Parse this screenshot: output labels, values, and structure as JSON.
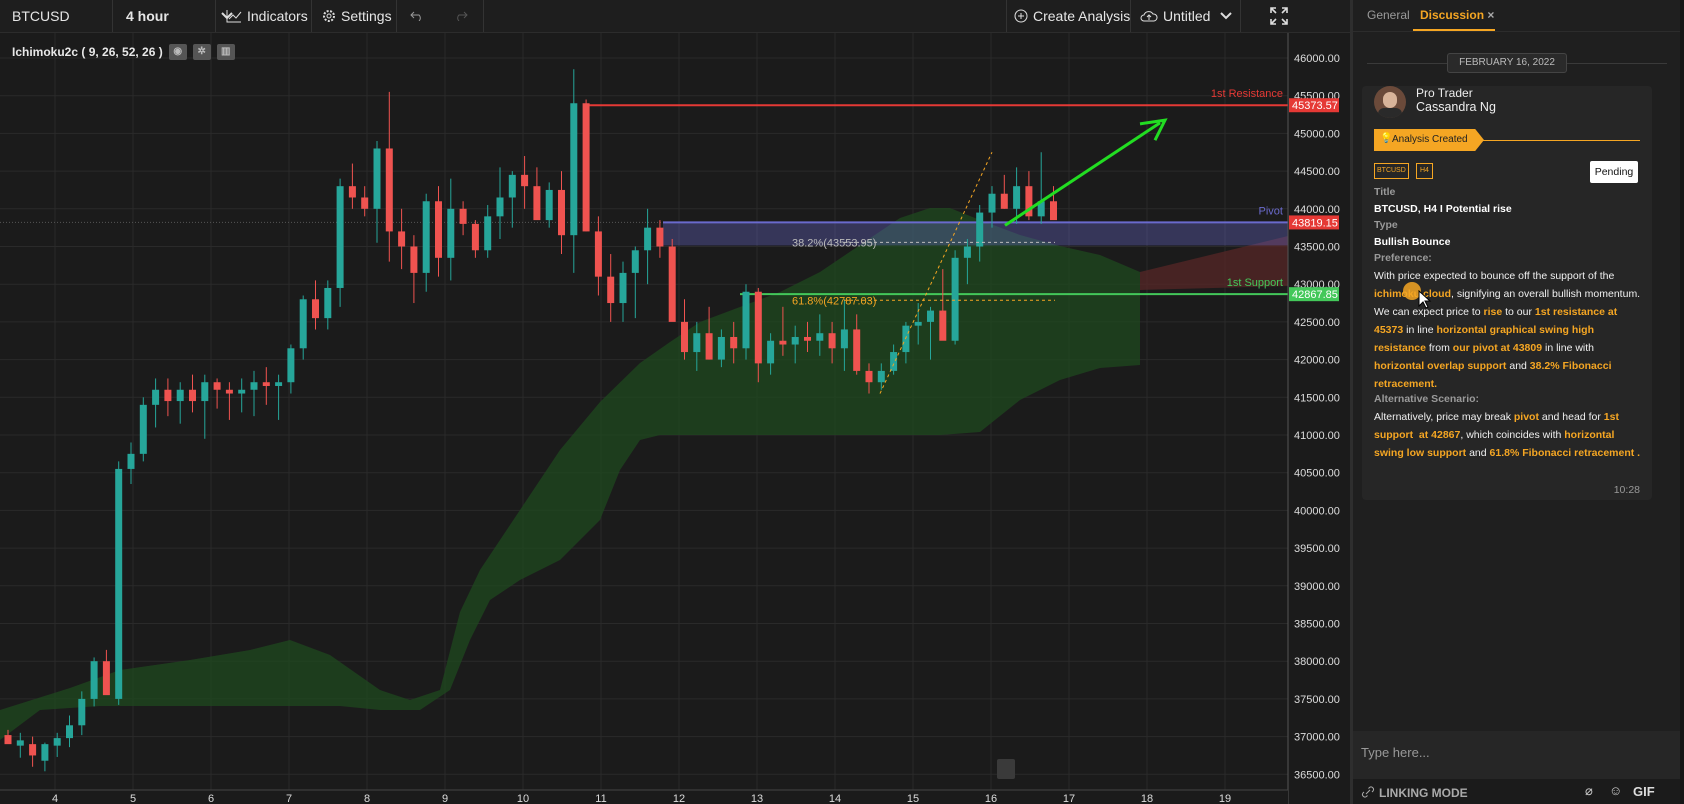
{
  "toolbar": {
    "symbol": "BTCUSD",
    "interval": "4 hour",
    "indicators_label": "Indicators",
    "settings_label": "Settings",
    "create_analysis_label": "Create Analysis",
    "layout_name": "Untitled"
  },
  "indicator": {
    "label": "Ichimoku2c ( 9, 26, 52, 26 )"
  },
  "price_axis": {
    "ticks": [
      "46000.00",
      "45500.00",
      "45000.00",
      "44500.00",
      "44000.00",
      "43500.00",
      "43000.00",
      "42500.00",
      "42000.00",
      "41500.00",
      "41000.00",
      "40500.00",
      "40000.00",
      "39500.00",
      "39000.00",
      "38500.00",
      "38000.00",
      "37500.00",
      "37000.00",
      "36500.00"
    ],
    "resistance_badge": "45373.57",
    "pivot_badge": "43819.15",
    "support_badge": "42867.85"
  },
  "time_axis": {
    "ticks": [
      "4",
      "5",
      "6",
      "7",
      "8",
      "9",
      "10",
      "11",
      "12",
      "13",
      "14",
      "15",
      "16",
      "17",
      "18",
      "19"
    ]
  },
  "annotations": {
    "resistance_label": "1st Resistance",
    "pivot_label": "Pivot",
    "support_label": "1st Support",
    "fib_382": "38.2%(43553.95)",
    "fib_618": "61.8%(42787.03)"
  },
  "colors": {
    "up": "#26a69a",
    "down": "#ef5350",
    "accent": "#f5a623",
    "resistance": "#e53935",
    "pivot": "#6a6acd",
    "support": "#43c85a",
    "arrow": "#22dd22"
  },
  "panel": {
    "tabs": [
      "General",
      "Discussion"
    ],
    "date": "FEBRUARY 16, 2022",
    "author_role": "Pro Trader",
    "author_name": "Cassandra Ng",
    "banner": "Analysis Created",
    "tags": [
      "BTCUSD",
      "H4"
    ],
    "status": "Pending",
    "title_label": "Title",
    "title": "BTCUSD, H4 I Potential rise",
    "type_label": "Type",
    "type": "Bullish Bounce",
    "pref_label": "Preference:",
    "alt_label": "Alternative Scenario:",
    "time": "10:28",
    "input_placeholder": "Type here...",
    "linking_mode": "LINKING MODE",
    "gif": "GIF"
  }
}
